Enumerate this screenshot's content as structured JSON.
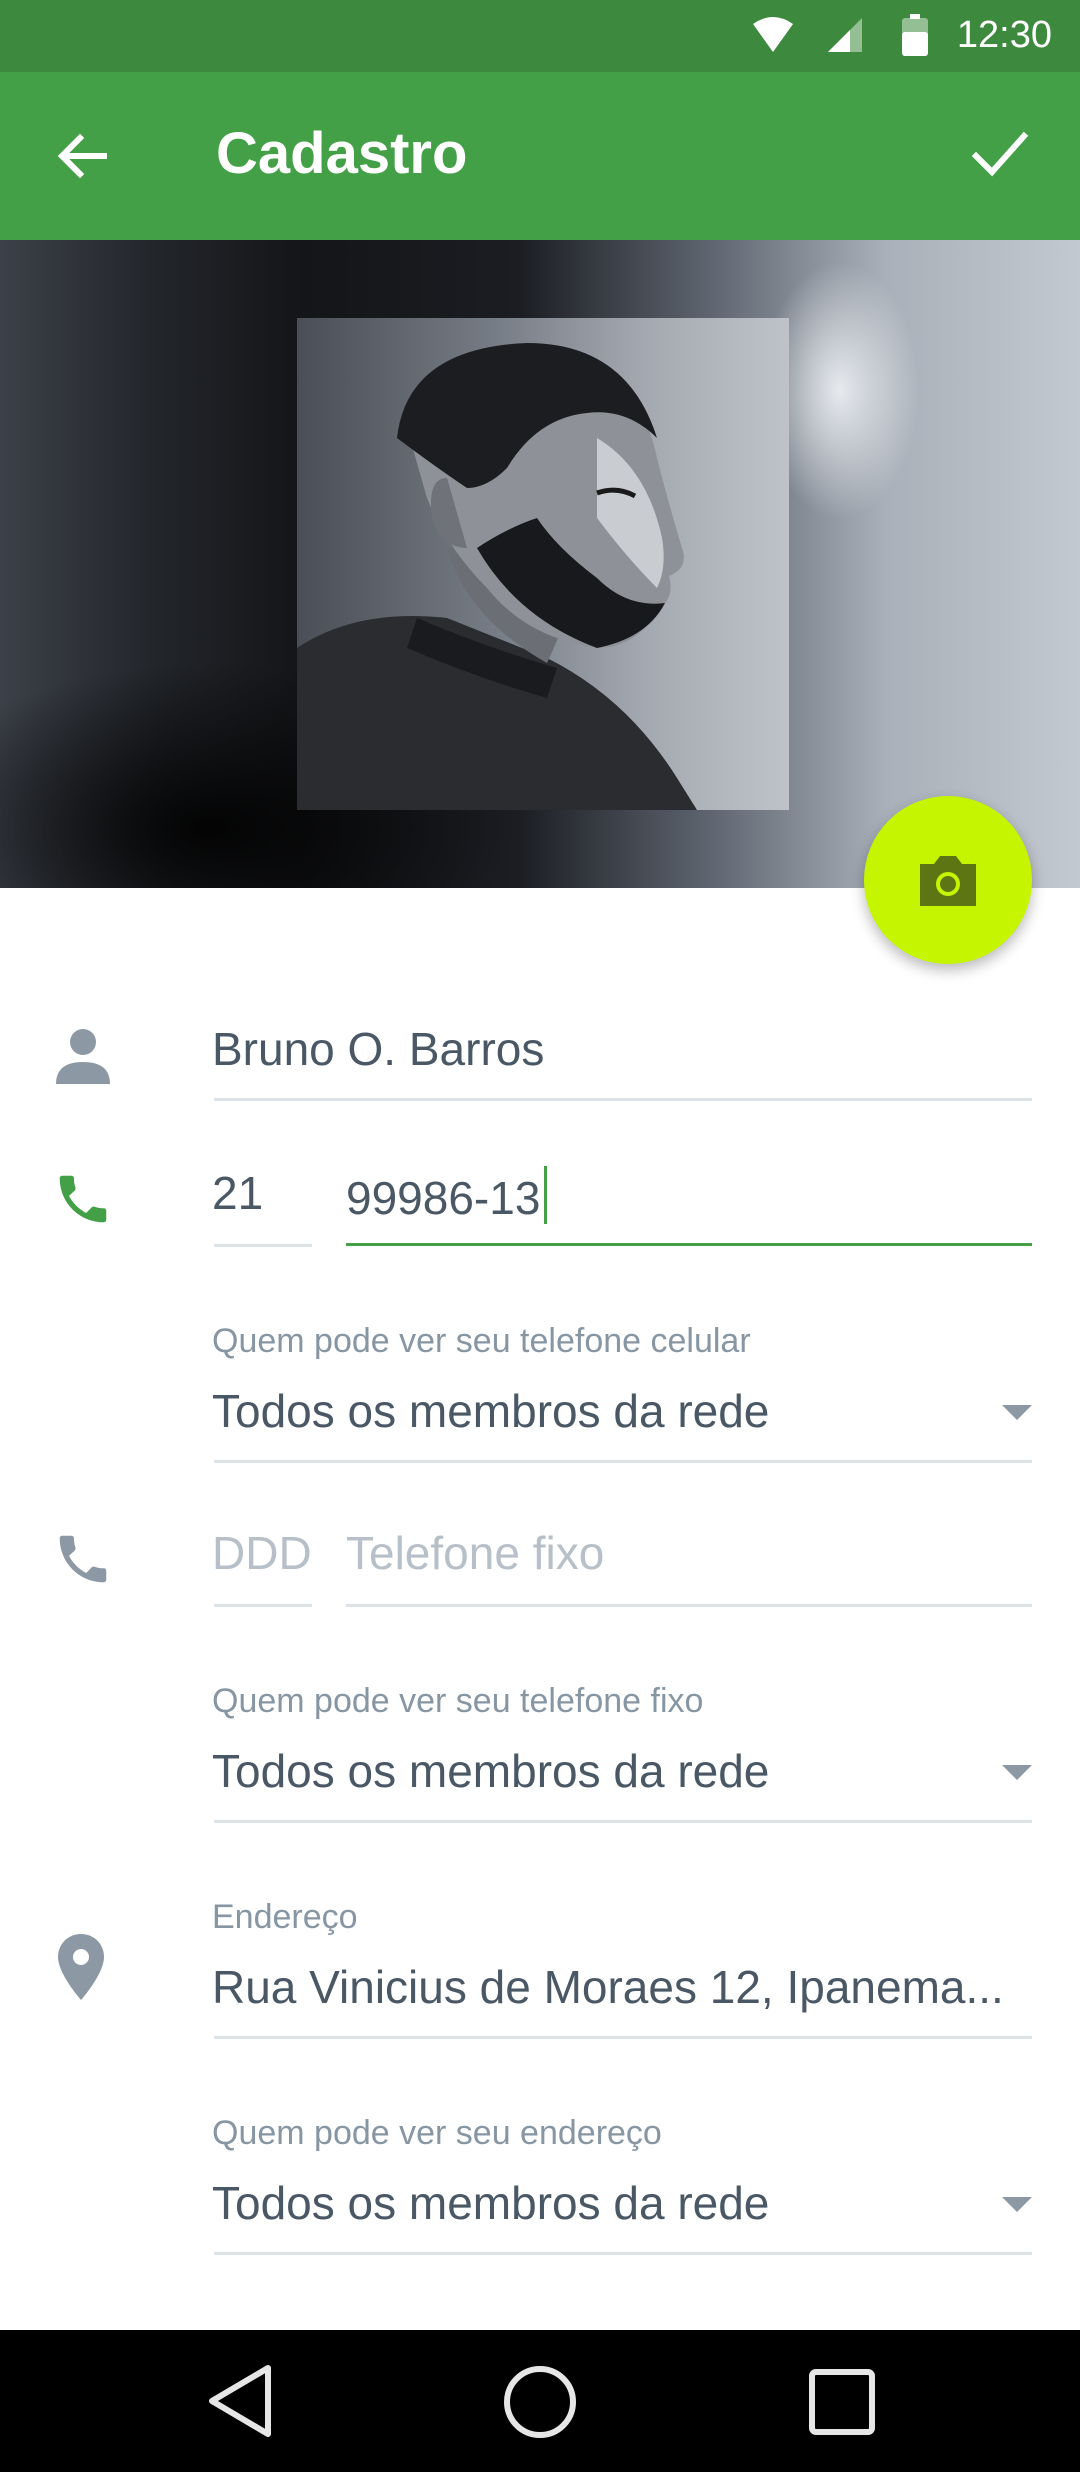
{
  "status_bar": {
    "time": "12:30"
  },
  "app_bar": {
    "title": "Cadastro"
  },
  "profile": {
    "name": "Bruno O. Barros"
  },
  "mobile": {
    "ddd": "21",
    "number": "99986-13",
    "visibility_label": "Quem pode ver seu telefone celular",
    "visibility_value": "Todos os membros da rede"
  },
  "landline": {
    "ddd_placeholder": "DDD",
    "number_placeholder": "Telefone fixo",
    "visibility_label": "Quem pode ver seu telefone fixo",
    "visibility_value": "Todos os membros da rede"
  },
  "address": {
    "label": "Endereço",
    "value": "Rua Vinicius de Moraes 12, Ipanema...",
    "visibility_label": "Quem pode ver seu endereço",
    "visibility_value": "Todos os membros da rede"
  },
  "colors": {
    "status_bar": "#3d8a3f",
    "app_bar": "#43a047",
    "accent": "#43a047",
    "fab": "#c6f500",
    "text": "#4a5866",
    "hint": "#8796a3"
  },
  "icons": {
    "back": "arrow-left",
    "confirm": "check",
    "camera": "camera",
    "person": "person",
    "phone": "phone",
    "location": "place"
  }
}
